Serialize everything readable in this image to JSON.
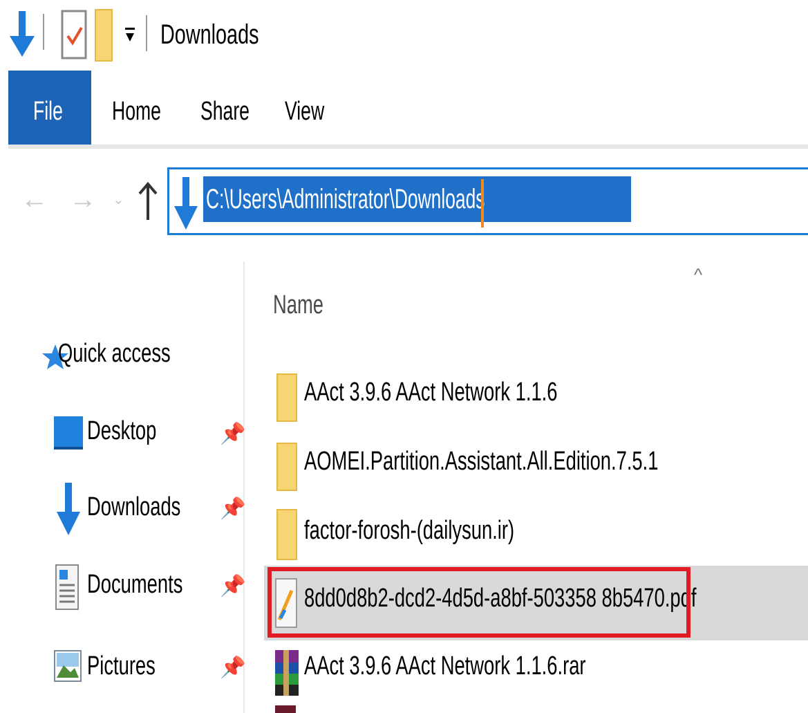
{
  "window": {
    "title": "Downloads"
  },
  "ribbon": {
    "tabs": [
      "File",
      "Home",
      "Share",
      "View"
    ]
  },
  "address_bar": {
    "path": "C:\\Users\\Administrator\\Downloads"
  },
  "nav_pane": {
    "items": [
      {
        "label": "Quick access",
        "icon": "star-icon",
        "pinned": false
      },
      {
        "label": "Desktop",
        "icon": "desktop-icon",
        "pinned": true
      },
      {
        "label": "Downloads",
        "icon": "download-arrow-icon",
        "pinned": true
      },
      {
        "label": "Documents",
        "icon": "document-icon",
        "pinned": true
      },
      {
        "label": "Pictures",
        "icon": "pictures-icon",
        "pinned": true
      }
    ]
  },
  "file_list": {
    "column_header": "Name",
    "sort_indicator": "^",
    "rows": [
      {
        "name": "AAct 3.9.6 AAct Network 1.1.6",
        "icon": "folder-icon"
      },
      {
        "name": "AOMEI.Partition.Assistant.All.Edition.7.5.1",
        "icon": "folder-icon"
      },
      {
        "name": "factor-forosh-(dailysun.ir)",
        "icon": "folder-icon"
      },
      {
        "name": "8dd0d8b2-dcd2-4d5d-a8bf-503358 8b5470.pdf",
        "icon": "pdf-file-icon",
        "selected": true
      },
      {
        "name": "AAct 3.9.6 AAct Network 1.1.6.rar",
        "icon": "winrar-archive-icon"
      }
    ]
  },
  "colors": {
    "file_tab": "#1e64b6",
    "address_border": "#1e7bd6",
    "selection": "#1e70c8",
    "highlight_box": "#e01b24",
    "folder": "#f6d572"
  }
}
